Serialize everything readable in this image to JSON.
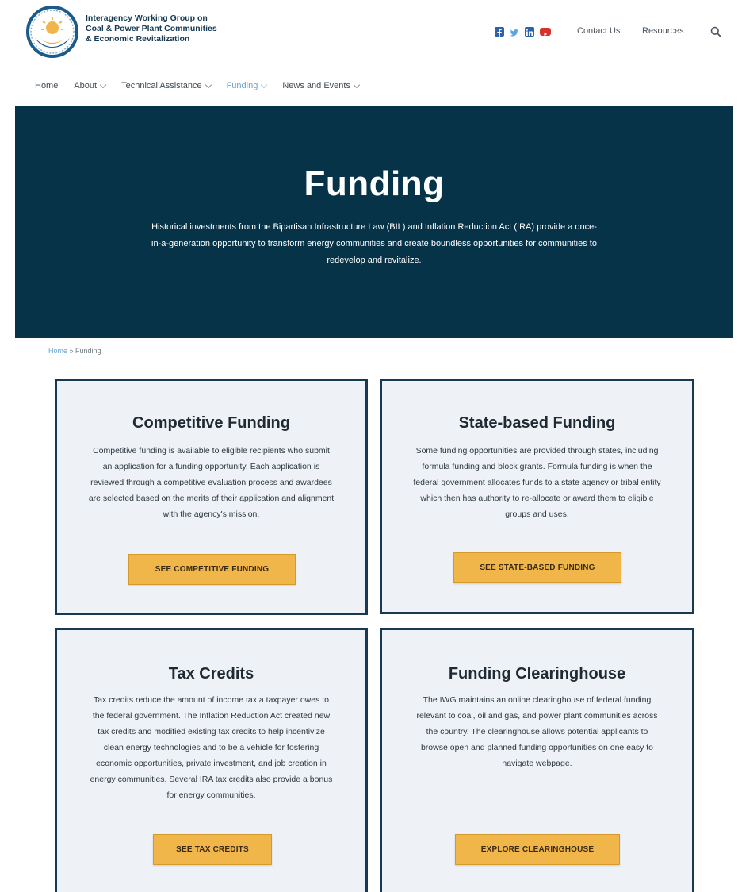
{
  "header": {
    "org_name_lines": [
      "Interagency Working Group on",
      "Coal & Power Plant Communities",
      "& Economic Revitalization"
    ],
    "social_icons": [
      "facebook-icon",
      "twitter-icon",
      "linkedin-icon",
      "youtube-icon"
    ],
    "links": [
      "Contact Us",
      "Resources"
    ],
    "search_icon": "search-icon"
  },
  "nav": {
    "items": [
      {
        "label": "Home"
      },
      {
        "label": "About"
      },
      {
        "label": "Technical Assistance"
      },
      {
        "label": "Funding"
      },
      {
        "label": "News and Events"
      }
    ],
    "active": "Funding"
  },
  "hero": {
    "title": "Funding",
    "text": "Historical investments from the Bipartisan Infrastructure Law (BIL) and Inflation Reduction Act (IRA) provide a once-in-a-generation opportunity to transform energy communities and create boundless opportunities for communities to redevelop and revitalize."
  },
  "breadcrumb": {
    "home": "Home",
    "separator": " » ",
    "current": "Funding"
  },
  "cards": [
    {
      "title": "Competitive Funding",
      "text": "Competitive funding is available to eligible recipients who submit an application for a funding opportunity. Each application is reviewed through a competitive evaluation process and awardees are selected based on the merits of their application and alignment with the agency's mission.",
      "button": "SEE COMPETITIVE FUNDING"
    },
    {
      "title": "State-based Funding",
      "text": "Some funding opportunities are provided through states, including formula funding and block grants. Formula funding is when the federal government allocates funds to a state agency or tribal entity which then has authority to re-allocate or award them to eligible groups and uses.",
      "button": "SEE STATE-BASED FUNDING"
    },
    {
      "title": "Tax Credits",
      "text": "Tax credits reduce the amount of income tax a taxpayer owes to the federal government. The Inflation Reduction Act created new tax credits and modified existing tax credits to help incentivize clean energy technologies and to be a vehicle for fostering economic opportunities, private investment, and job creation in energy communities. Several IRA tax credits also provide a bonus for energy communities.",
      "button": "SEE TAX CREDITS"
    },
    {
      "title": "Funding Clearinghouse",
      "text": "The IWG maintains an online clearinghouse of federal funding relevant to coal, oil and gas, and power plant communities across the country. The clearinghouse allows potential applicants to browse open and planned funding opportunities on one easy to navigate webpage.",
      "button": "EXPLORE CLEARINGHOUSE"
    }
  ],
  "colors": {
    "hero_bg": "#073349",
    "card_border": "#173a52",
    "card_bg": "#eef2f6",
    "button_bg": "#f0b64a",
    "link_blue": "#6aa1cf"
  }
}
